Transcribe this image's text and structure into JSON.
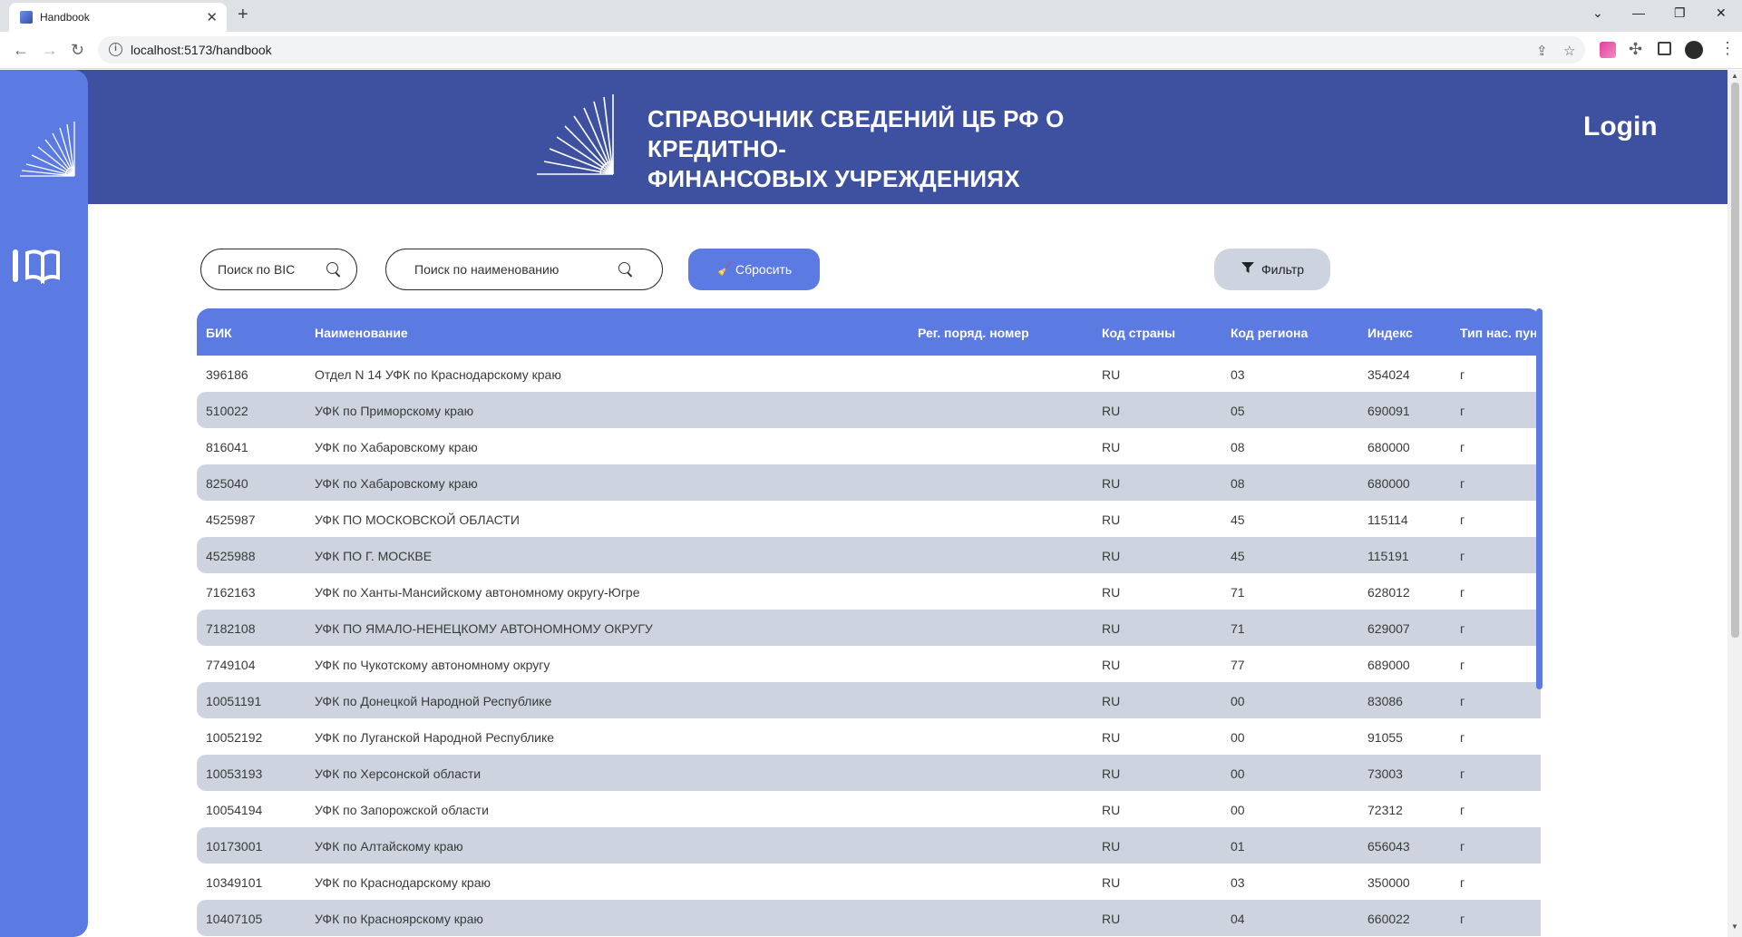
{
  "browser": {
    "tab_title": "Handbook",
    "tab_close": "✕",
    "new_tab": "+",
    "url": "localhost:5173/handbook",
    "win_minimize": "—",
    "win_restore": "❐",
    "win_close": "✕",
    "win_dropdown": "⌄"
  },
  "header": {
    "title_line1": "СПРАВОЧНИК СВЕДЕНИЙ ЦБ РФ О КРЕДИТНО-",
    "title_line2": "ФИНАНСОВЫХ УЧРЕЖДЕНИЯХ",
    "login": "Login"
  },
  "toolbar": {
    "search_bic_placeholder": "Поиск по BIC",
    "search_name_placeholder": "Поиск по наименованию",
    "reset_label": "Сбросить",
    "filter_label": "Фильтр"
  },
  "table": {
    "columns": [
      "БИК",
      "Наименование",
      "Рег. поряд. номер",
      "Код страны",
      "Код региона",
      "Индекс",
      "Тип нас. пун"
    ],
    "rows": [
      [
        "396186",
        "Отдел N 14 УФК по Краснодарскому краю",
        "",
        "RU",
        "03",
        "354024",
        "г"
      ],
      [
        "510022",
        "УФК по Приморскому краю",
        "",
        "RU",
        "05",
        "690091",
        "г"
      ],
      [
        "816041",
        "УФК по Хабаровскому краю",
        "",
        "RU",
        "08",
        "680000",
        "г"
      ],
      [
        "825040",
        "УФК по Хабаровскому краю",
        "",
        "RU",
        "08",
        "680000",
        "г"
      ],
      [
        "4525987",
        "УФК ПО МОСКОВСКОЙ ОБЛАСТИ",
        "",
        "RU",
        "45",
        "115114",
        "г"
      ],
      [
        "4525988",
        "УФК ПО Г. МОСКВЕ",
        "",
        "RU",
        "45",
        "115191",
        "г"
      ],
      [
        "7162163",
        "УФК по Ханты-Мансийскому автономному округу-Югре",
        "",
        "RU",
        "71",
        "628012",
        "г"
      ],
      [
        "7182108",
        "УФК ПО ЯМАЛО-НЕНЕЦКОМУ АВТОНОМНОМУ ОКРУГУ",
        "",
        "RU",
        "71",
        "629007",
        "г"
      ],
      [
        "7749104",
        "УФК по Чукотскому автономному округу",
        "",
        "RU",
        "77",
        "689000",
        "г"
      ],
      [
        "10051191",
        "УФК по Донецкой Народной Республике",
        "",
        "RU",
        "00",
        "83086",
        "г"
      ],
      [
        "10052192",
        "УФК по Луганской Народной Республике",
        "",
        "RU",
        "00",
        "91055",
        "г"
      ],
      [
        "10053193",
        "УФК по Херсонской области",
        "",
        "RU",
        "00",
        "73003",
        "г"
      ],
      [
        "10054194",
        "УФК по Запорожской области",
        "",
        "RU",
        "00",
        "72312",
        "г"
      ],
      [
        "10173001",
        "УФК по Алтайскому краю",
        "",
        "RU",
        "01",
        "656043",
        "г"
      ],
      [
        "10349101",
        "УФК по Краснодарскому краю",
        "",
        "RU",
        "03",
        "350000",
        "г"
      ],
      [
        "10407105",
        "УФК по Красноярскому краю",
        "",
        "RU",
        "04",
        "660022",
        "г"
      ]
    ]
  },
  "colors": {
    "header_bg": "#3d51a0",
    "accent": "#5b7be3",
    "row_alt": "#cdd4df"
  }
}
